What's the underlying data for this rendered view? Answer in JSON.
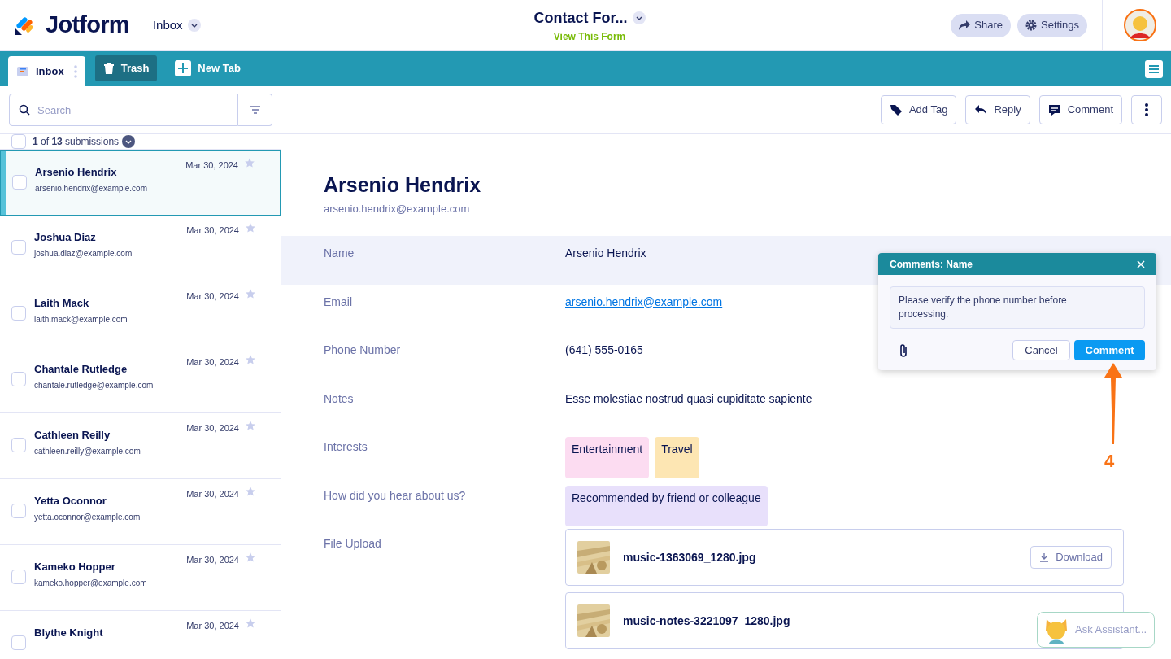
{
  "header": {
    "logo": "Jotform",
    "section": "Inbox",
    "form_title": "Contact For...",
    "form_link": "View This Form",
    "buttons": [
      "Share",
      "Settings"
    ]
  },
  "tabs": [
    {
      "label": "Inbox",
      "kind": "inbox",
      "selected": true
    },
    {
      "label": "Trash",
      "kind": "trash",
      "selected": false
    },
    {
      "label": "New Tab",
      "kind": "new",
      "selected": false
    }
  ],
  "search": {
    "placeholder": "Search"
  },
  "toolbar": [
    {
      "label": "Add Tag",
      "kind": "tag"
    },
    {
      "label": "Reply",
      "kind": "reply"
    },
    {
      "label": "Comment",
      "kind": "comment"
    },
    {
      "kind": "more"
    }
  ],
  "list_header": {
    "text": "**1** of **13** submissions",
    "checked": false
  },
  "submissions": [
    {
      "name": "Arsenio Hendrix",
      "email": "arsenio.hendrix@example.com",
      "date": "Mar 30, 2024",
      "selected": true,
      "checked": false
    },
    {
      "name": "Joshua Diaz",
      "email": "joshua.diaz@example.com",
      "date": "Mar 30, 2024",
      "selected": false,
      "checked": false
    },
    {
      "name": "Laith Mack",
      "email": "laith.mack@example.com",
      "date": "Mar 30, 2024",
      "selected": false,
      "checked": false
    },
    {
      "name": "Chantale Rutledge",
      "email": "chantale.rutledge@example.com",
      "date": "Mar 30, 2024",
      "selected": false,
      "checked": false
    },
    {
      "name": "Cathleen Reilly",
      "email": "cathleen.reilly@example.com",
      "date": "Mar 30, 2024",
      "selected": false,
      "checked": false
    },
    {
      "name": "Yetta Oconnor",
      "email": "yetta.oconnor@example.com",
      "date": "Mar 30, 2024",
      "selected": false,
      "checked": false
    },
    {
      "name": "Kameko Hopper",
      "email": "kameko.hopper@example.com",
      "date": "Mar 30, 2024",
      "selected": false,
      "checked": false
    },
    {
      "name": "Blythe Knight",
      "date": "Mar 30, 2024",
      "selected": false,
      "checked": false
    }
  ],
  "detail": {
    "name": "Arsenio Hendrix",
    "email": "arsenio.hendrix@example.com",
    "fields": [
      {
        "label": "Name",
        "kind": "text",
        "value": "Arsenio Hendrix",
        "selected": true
      },
      {
        "label": "Email",
        "kind": "link",
        "value": "arsenio.hendrix@example.com",
        "selected": false
      },
      {
        "label": "Phone Number",
        "kind": "text",
        "value": "(641) 555-0165",
        "selected": false
      },
      {
        "label": "Notes",
        "kind": "text",
        "value": "Esse molestiae nostrud quasi cupiditate sapiente",
        "selected": false
      },
      {
        "label": "Interests",
        "kind": "tags",
        "tags": [
          {
            "text": "Entertainment",
            "color": "#fcdcf1"
          },
          {
            "text": "Travel",
            "color": "#fde6b3"
          }
        ],
        "selected": false
      },
      {
        "label": "How did you hear about us?",
        "kind": "tags",
        "tags": [
          {
            "text": "Recommended by friend or colleague",
            "color": "#e8e0fb"
          }
        ],
        "selected": false
      },
      {
        "label": "File Upload",
        "kind": "files",
        "files": [
          {
            "name": "music-1363069_1280.jpg",
            "button": "Download"
          },
          {
            "name": "music-notes-3221097_1280.jpg"
          }
        ],
        "selected": false
      }
    ]
  },
  "comment_popup": {
    "title": "Comments: Name",
    "text": "Please verify the phone number before processing.",
    "buttons": [
      "Cancel",
      "Comment"
    ]
  },
  "assistant": {
    "label": "Ask Assistant..."
  },
  "annotation": {
    "label": "4"
  }
}
